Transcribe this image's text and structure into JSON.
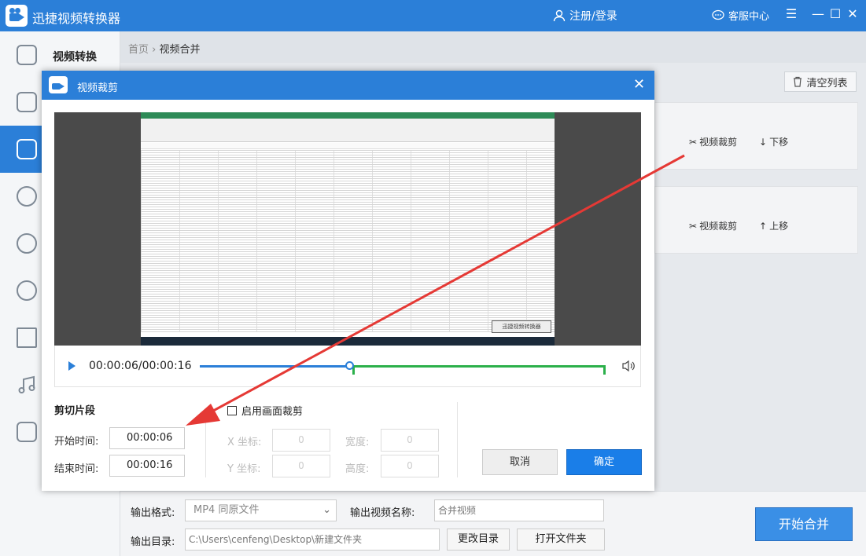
{
  "app": {
    "title": "迅捷视频转换器",
    "login": "注册/登录",
    "service": "客服中心",
    "accent": "#2b7fd8"
  },
  "sidebar": {
    "items": [
      {
        "label": "视频转换",
        "icon": "convert-icon"
      },
      {
        "label": "",
        "icon": "split-icon"
      },
      {
        "label": "",
        "icon": "merge-icon"
      },
      {
        "label": "",
        "icon": "gif-icon"
      },
      {
        "label": "",
        "icon": "compress-icon"
      },
      {
        "label": "",
        "icon": "film-reel-icon"
      },
      {
        "label": "",
        "icon": "image-icon"
      },
      {
        "label": "",
        "icon": "music-icon"
      },
      {
        "label": "",
        "icon": "adjust-icon"
      }
    ]
  },
  "breadcrumb": {
    "home": "首页",
    "sep": "›",
    "current": "视频合并"
  },
  "list": {
    "clear_label": "清空列表",
    "rows": [
      {
        "crop": "视频裁剪",
        "move": "下移"
      },
      {
        "crop": "视频裁剪",
        "move": "上移"
      }
    ]
  },
  "dialog": {
    "title": "视频裁剪",
    "time_display": "00:00:06/00:00:16",
    "progress_fraction": 0.375,
    "section_title": "剪切片段",
    "start_label": "开始时间:",
    "start_value": "00:00:06",
    "end_label": "结束时间:",
    "end_value": "00:00:16",
    "crop_enable": "启用画面裁剪",
    "x_label": "X 坐标:",
    "y_label": "Y 坐标:",
    "w_label": "宽度:",
    "h_label": "高度:",
    "x_value": "0",
    "y_value": "0",
    "w_value": "0",
    "h_value": "0",
    "cancel": "取消",
    "ok": "确定",
    "video_watermark": "迅捷视频转换器"
  },
  "bottom": {
    "format_label": "输出格式:",
    "format_value": "MP4  同原文件",
    "name_label": "输出视频名称:",
    "name_value": "合并视频",
    "dir_label": "输出目录:",
    "dir_value": "C:\\Users\\cenfeng\\Desktop\\新建文件夹",
    "change_dir": "更改目录",
    "open_folder": "打开文件夹",
    "start": "开始合并"
  }
}
